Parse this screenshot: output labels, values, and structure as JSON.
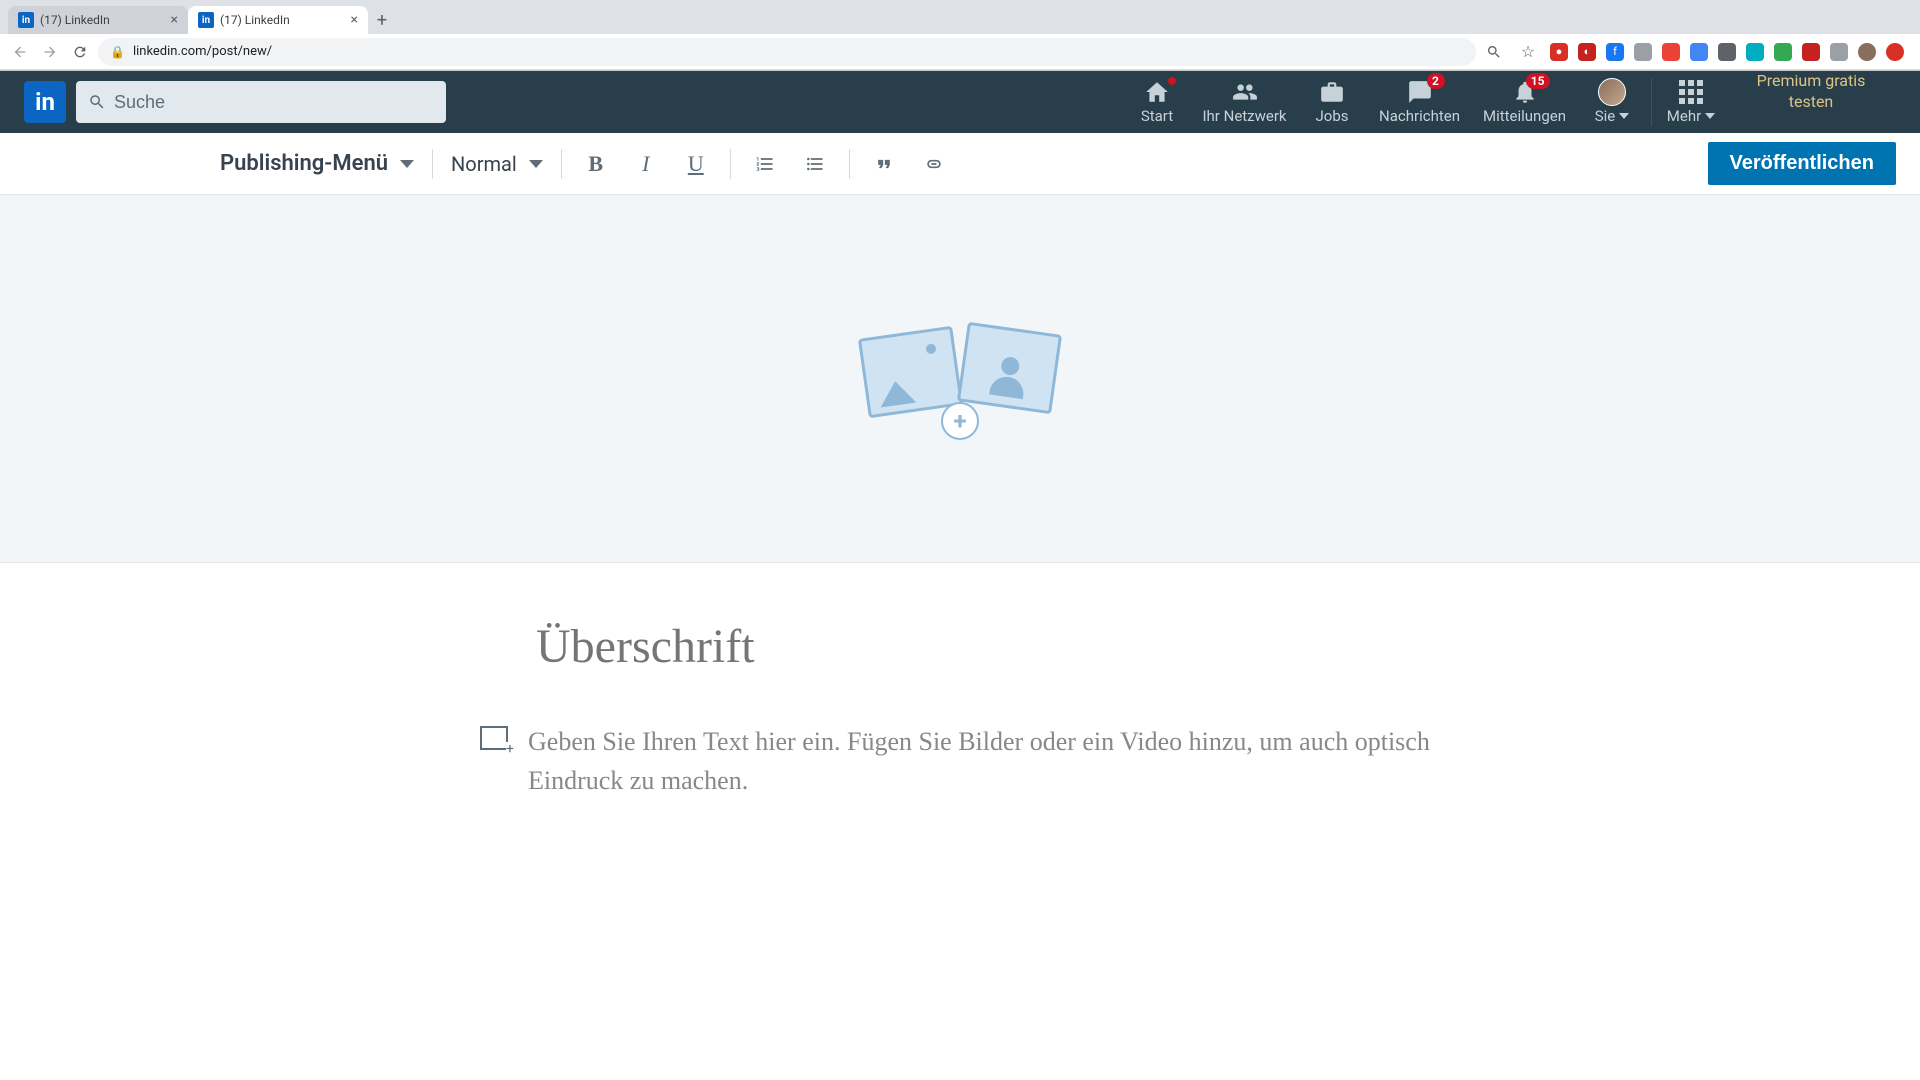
{
  "browser": {
    "tabs": [
      {
        "title": "(17) LinkedIn",
        "active": false
      },
      {
        "title": "(17) LinkedIn",
        "active": true
      }
    ],
    "url": "linkedin.com/post/new/"
  },
  "linkedin_nav": {
    "search_placeholder": "Suche",
    "items": {
      "home": {
        "label": "Start",
        "badge": "•"
      },
      "network": {
        "label": "Ihr Netzwerk"
      },
      "jobs": {
        "label": "Jobs"
      },
      "messaging": {
        "label": "Nachrichten",
        "badge": "2"
      },
      "notifications": {
        "label": "Mitteilungen",
        "badge": "15"
      },
      "me": {
        "label": "Sie"
      },
      "more": {
        "label": "Mehr"
      }
    },
    "premium_cta": "Premium gratis testen"
  },
  "toolbar": {
    "publishing_menu": "Publishing-Menü",
    "style_dropdown": "Normal",
    "publish_button": "Veröffentlichen"
  },
  "editor": {
    "heading_placeholder": "Überschrift",
    "body_placeholder": "Geben Sie Ihren Text hier ein. Fügen Sie Bilder oder ein Video hinzu, um auch optisch Eindruck zu machen."
  }
}
